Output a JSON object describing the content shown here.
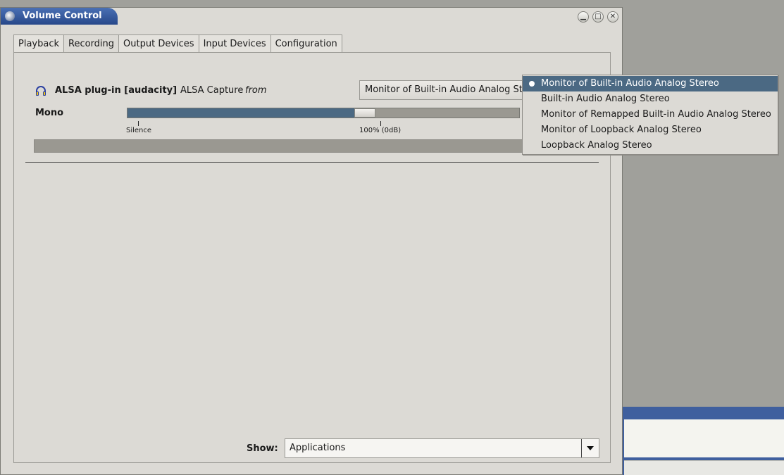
{
  "window": {
    "title": "Volume Control"
  },
  "tabs": [
    "Playback",
    "Recording",
    "Output Devices",
    "Input Devices",
    "Configuration"
  ],
  "active_tab": "Recording",
  "stream": {
    "name": "ALSA plug-in [audacity]",
    "separator": ":",
    "subtitle": "ALSA Capture",
    "from_label": "from",
    "device": "Monitor of Built-in Audio Analog Stereo",
    "channel_label": "Mono",
    "volume_fraction": 0.578,
    "ticks": {
      "silence": "Silence",
      "full": "100% (0dB)"
    }
  },
  "device_menu": {
    "items": [
      "Monitor of Built-in Audio Analog Stereo",
      "Built-in Audio Analog Stereo",
      "Monitor of Remapped Built-in Audio Analog Stereo",
      "Monitor of Loopback Analog Stereo",
      "Loopback Analog Stereo"
    ],
    "selected_index": 0
  },
  "show": {
    "label": "Show:",
    "value": "Applications"
  },
  "colors": {
    "accent": "#4b6983",
    "title_bar": "#27488a",
    "window_bg": "#dcdad5"
  }
}
